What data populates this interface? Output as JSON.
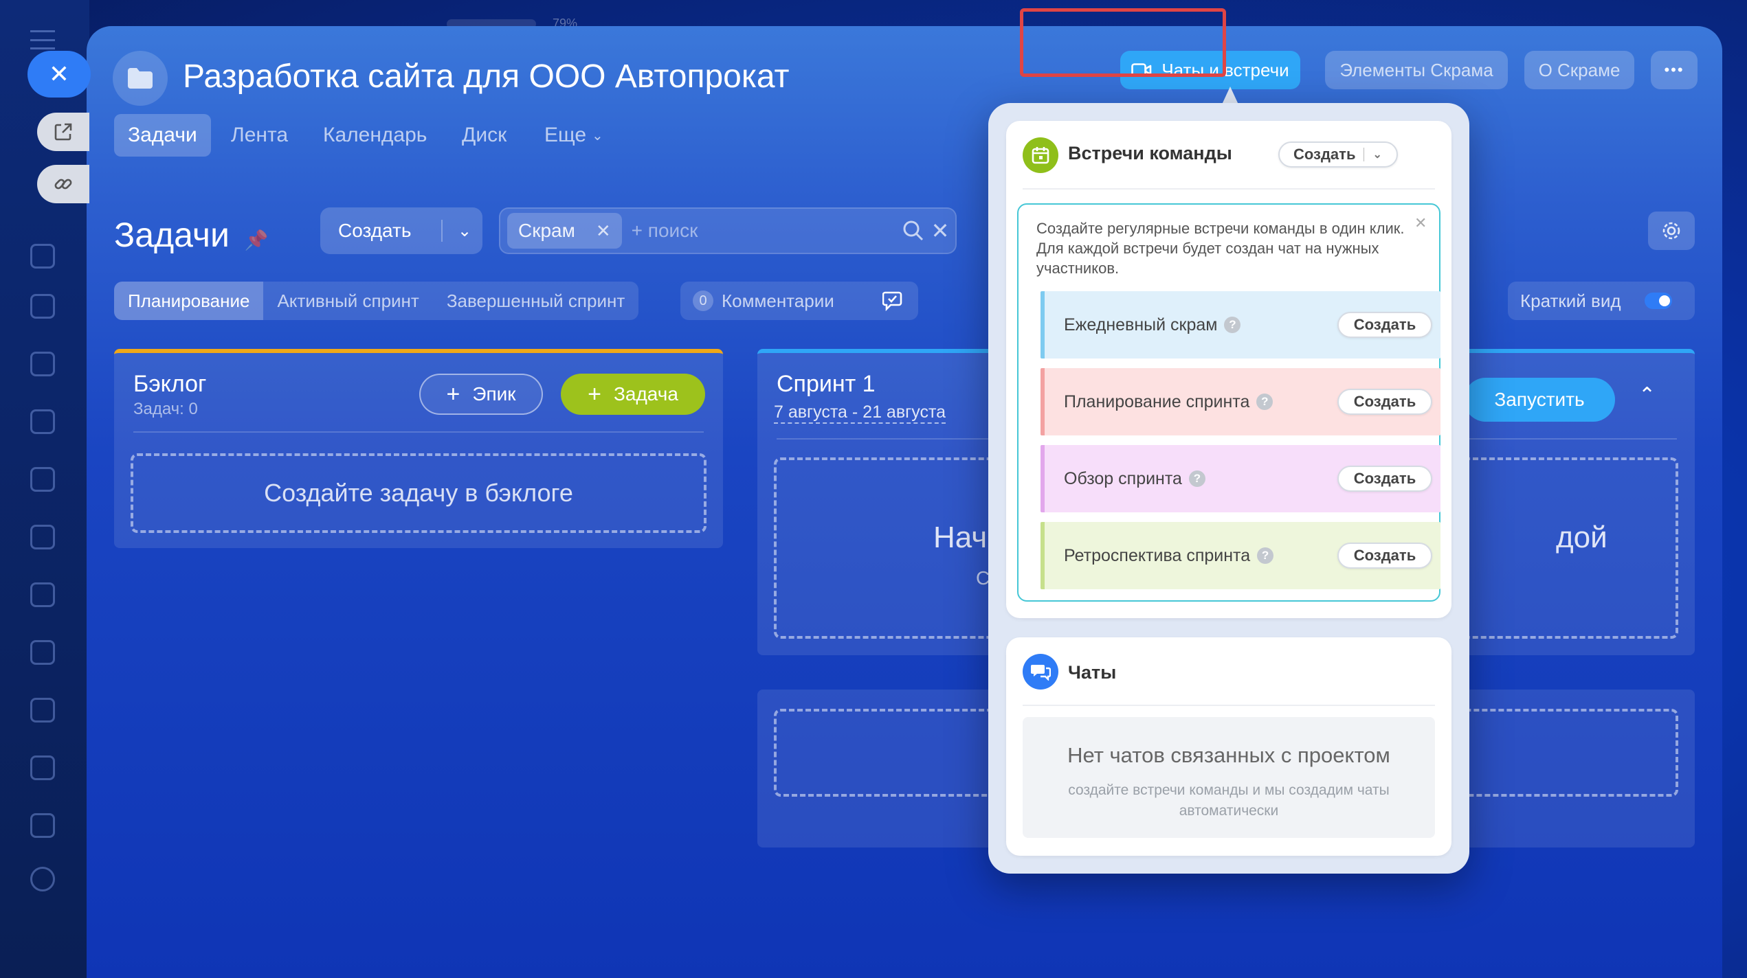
{
  "status_bar": {
    "battery": "79%"
  },
  "project": {
    "title": "Разработка сайта для ООО Автопрокат"
  },
  "header_buttons": {
    "chats_meetings": "Чаты и встречи",
    "scrum_elements": "Элементы Скрама",
    "about_scrum": "О Скраме",
    "more": "•••"
  },
  "nav_tabs": [
    {
      "label": "Задачи",
      "active": true
    },
    {
      "label": "Лента"
    },
    {
      "label": "Календарь"
    },
    {
      "label": "Диск"
    },
    {
      "label": "Еще"
    }
  ],
  "tasks": {
    "title": "Задачи",
    "create_button": "Создать",
    "filter_chip": "Скрам",
    "search_placeholder": "+ поиск"
  },
  "view_tabs": [
    {
      "label": "Планирование",
      "active": true
    },
    {
      "label": "Активный спринт"
    },
    {
      "label": "Завершенный спринт"
    }
  ],
  "comments": {
    "count": "0",
    "label": "Комментарии"
  },
  "short_view": {
    "label": "Краткий вид",
    "enabled": true
  },
  "backlog": {
    "title": "Бэклог",
    "count": "Задач: 0",
    "epic_button": "Эпик",
    "task_button": "Задача",
    "empty_text": "Создайте задачу в бэклоге"
  },
  "sprint": {
    "title": "Спринт 1",
    "dates": "7 августа - 21 августа",
    "start_button": "Запустить",
    "placeholder_left": "Нач",
    "placeholder_left_sub": "С",
    "placeholder_right": "дой"
  },
  "popup": {
    "meetings_title": "Встречи команды",
    "meetings_create": "Создать",
    "hint_text": "Создайте регулярные встречи команды в один клик. Для каждой встречи будет создан чат на нужных участников.",
    "meetings": [
      {
        "label": "Ежедневный скрам",
        "button": "Создать",
        "color": "#dff0fb",
        "accent": "#7ecbf0"
      },
      {
        "label": "Планирование спринта",
        "button": "Создать",
        "color": "#fde1e1",
        "accent": "#f3a2a2"
      },
      {
        "label": "Обзор спринта",
        "button": "Создать",
        "color": "#f7defa",
        "accent": "#e2a7ec"
      },
      {
        "label": "Ретроспектива спринта",
        "button": "Создать",
        "color": "#eef6dc",
        "accent": "#c6e08c"
      }
    ],
    "chats_title": "Чаты",
    "no_chats_title": "Нет чатов связанных с проектом",
    "no_chats_text": "создайте встречи команды и мы создадим чаты автоматически"
  },
  "colors": {
    "accent_blue": "#2fa6f7",
    "task_green": "#9dc21c",
    "highlight_red": "#e04545",
    "meetings_icon": "#8fbf1a",
    "chats_icon": "#2f7cf6"
  }
}
